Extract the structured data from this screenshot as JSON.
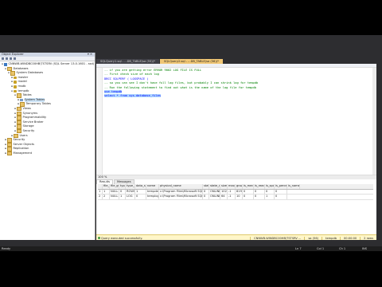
{
  "object_explorer": {
    "title": "Object Explorer",
    "pin": "▾ ✕",
    "tree": [
      {
        "label": "CNNWB-WINDBC00HB\\TSTSRV (SQL Server 13.0.1601 - ssd)",
        "icon": "server-icon",
        "expanded": true
      },
      {
        "label": "Databases",
        "icon": "folder-icon",
        "expanded": true
      },
      {
        "label": "System Databases",
        "icon": "folder-icon",
        "expanded": true
      },
      {
        "label": "master",
        "icon": "database-icon",
        "expanded": false
      },
      {
        "label": "model",
        "icon": "database-icon",
        "expanded": false
      },
      {
        "label": "msdb",
        "icon": "database-icon",
        "expanded": false
      },
      {
        "label": "tempdb",
        "icon": "database-icon",
        "expanded": true
      },
      {
        "label": "Tables",
        "icon": "folder-icon",
        "expanded": true
      },
      {
        "label": "System Tables",
        "icon": "table-icon",
        "expanded": false,
        "selected": true
      },
      {
        "label": "Temporary Tables",
        "icon": "folder-icon",
        "expanded": false
      },
      {
        "label": "Views",
        "icon": "folder-icon",
        "expanded": false
      },
      {
        "label": "Synonyms",
        "icon": "folder-icon",
        "expanded": false
      },
      {
        "label": "Programmability",
        "icon": "folder-icon",
        "expanded": false
      },
      {
        "label": "Service Broker",
        "icon": "folder-icon",
        "expanded": false
      },
      {
        "label": "Storage",
        "icon": "folder-icon",
        "expanded": false
      },
      {
        "label": "Security",
        "icon": "folder-icon",
        "expanded": false
      },
      {
        "label": "Users",
        "icon": "folder-icon",
        "expanded": false
      },
      {
        "label": "Security",
        "icon": "folder-icon",
        "expanded": false
      },
      {
        "label": "Server Objects",
        "icon": "folder-icon",
        "expanded": false
      },
      {
        "label": "Replication",
        "icon": "folder-icon",
        "expanded": false
      },
      {
        "label": "Management",
        "icon": "folder-icon",
        "expanded": false
      }
    ]
  },
  "tabs": [
    {
      "label": "SQLQuery1.sql - ...DB_TABLE(sa (55))*",
      "active": false
    },
    {
      "label": "SQLQuery2.sql - ...DB_TABLE(sa (56))*",
      "active": true
    }
  ],
  "editor": {
    "lines": [
      {
        "text": "-- if you are getting error ERROR 9002 LOG FILE IS FULL",
        "kind": "comment",
        "highlight": false
      },
      {
        "text": "-- First check size of each log",
        "kind": "comment",
        "highlight": false
      },
      {
        "text": "DBCC SQLPERF ( LOGSPACE )",
        "kind": "keyword",
        "highlight": false
      },
      {
        "text": "-- so you can see I don't have full log files, but probably I can shrink log for tempdb",
        "kind": "comment",
        "highlight": false
      },
      {
        "text": "-- Run the following statement to find out what is the name of the log file for tempdb",
        "kind": "comment",
        "highlight": false
      },
      {
        "text": "use tempdb",
        "kind": "keyword",
        "highlight": true
      },
      {
        "text": "select * from sys.database_files",
        "kind": "keyword",
        "highlight": true
      }
    ],
    "zoom": "100 %"
  },
  "results": {
    "tabs": [
      "Results",
      "Messages"
    ],
    "columns": [
      "file_id",
      "file_guid",
      "type",
      "type_desc",
      "data_space_id",
      "name",
      "physical_name",
      "state",
      "state_desc",
      "size",
      "max_size",
      "growth",
      "is_media_read_only",
      "is_read_only",
      "is_sparse",
      "is_percent_growth",
      "is_name_reserved"
    ],
    "rows": [
      [
        "1",
        "1",
        "NULL",
        "0",
        "ROWS",
        "1",
        "tempdev",
        "c:\\Program Files\\Microsoft SQL Server\\MSSQ...",
        "0",
        "ONLINE",
        "1024",
        "-1",
        "8192",
        "0",
        "0",
        "0",
        "0"
      ],
      [
        "2",
        "2",
        "NULL",
        "1",
        "LOG",
        "0",
        "templog",
        "c:\\Program Files\\Microsoft SQL Server\\MSSQ...",
        "0",
        "ONLINE",
        "64",
        "-1",
        "10",
        "0",
        "0",
        "1",
        "0"
      ]
    ]
  },
  "query_status": {
    "message": "Query executed successfully.",
    "server": "CNNWB-WINDBC00HB\\TSTSRV ...",
    "user": "sa (56)",
    "database": "tempdb",
    "time": "00:00:00",
    "rows": "2 rows"
  },
  "statusbar": {
    "ready": "Ready",
    "ln": "Ln 7",
    "col": "Col 1",
    "ch": "Ch 1",
    "ins": "INS"
  }
}
